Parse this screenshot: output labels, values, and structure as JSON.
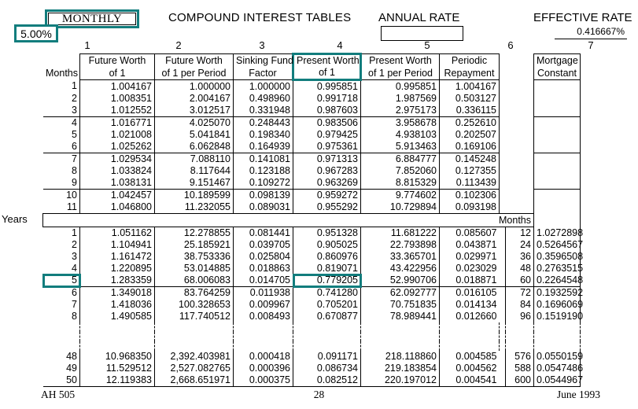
{
  "header": {
    "frequency_badge": "MONTHLY",
    "title": "COMPOUND INTEREST TABLES",
    "annual_rate_label": "ANNUAL RATE",
    "annual_rate_value": "5.00%",
    "effective_rate_label": "EFFECTIVE RATE",
    "effective_rate_value": "0.416667%",
    "effective_rate_column_number": "7",
    "highlight_color": "#127D7D"
  },
  "table": {
    "column_numbers": [
      "1",
      "2",
      "3",
      "4",
      "5",
      "6",
      "7"
    ],
    "row_label_header": "Months",
    "years_label": "Years",
    "months_label": "Months",
    "headers": [
      {
        "line1": "Future Worth",
        "line2": "of 1"
      },
      {
        "line1": "Future Worth",
        "line2": "of 1 per Period"
      },
      {
        "line1": "Sinking Fund",
        "line2": "Factor"
      },
      {
        "line1": "Present Worth",
        "line2": "of 1"
      },
      {
        "line1": "Present Worth",
        "line2": "of 1 per Period"
      },
      {
        "line1": "Periodic",
        "line2": "Repayment"
      },
      {
        "line1": "Mortgage",
        "line2": "Constant"
      }
    ],
    "highlighted_header_index": 3,
    "monthly_rows": [
      {
        "n": "1",
        "c1": "1.004167",
        "c2": "1.000000",
        "c3": "1.000000",
        "c4": "0.995851",
        "c5": "0.995851",
        "c6": "1.004167"
      },
      {
        "n": "2",
        "c1": "1.008351",
        "c2": "2.004167",
        "c3": "0.498960",
        "c4": "0.991718",
        "c5": "1.987569",
        "c6": "0.503127"
      },
      {
        "n": "3",
        "c1": "1.012552",
        "c2": "3.012517",
        "c3": "0.331948",
        "c4": "0.987603",
        "c5": "2.975173",
        "c6": "0.336115"
      },
      {
        "n": "4",
        "c1": "1.016771",
        "c2": "4.025070",
        "c3": "0.248443",
        "c4": "0.983506",
        "c5": "3.958678",
        "c6": "0.252610"
      },
      {
        "n": "5",
        "c1": "1.021008",
        "c2": "5.041841",
        "c3": "0.198340",
        "c4": "0.979425",
        "c5": "4.938103",
        "c6": "0.202507"
      },
      {
        "n": "6",
        "c1": "1.025262",
        "c2": "6.062848",
        "c3": "0.164939",
        "c4": "0.975361",
        "c5": "5.913463",
        "c6": "0.169106"
      },
      {
        "n": "7",
        "c1": "1.029534",
        "c2": "7.088110",
        "c3": "0.141081",
        "c4": "0.971313",
        "c5": "6.884777",
        "c6": "0.145248"
      },
      {
        "n": "8",
        "c1": "1.033824",
        "c2": "8.117644",
        "c3": "0.123188",
        "c4": "0.967283",
        "c5": "7.852060",
        "c6": "0.127355"
      },
      {
        "n": "9",
        "c1": "1.038131",
        "c2": "9.151467",
        "c3": "0.109272",
        "c4": "0.963269",
        "c5": "8.815329",
        "c6": "0.113439"
      },
      {
        "n": "10",
        "c1": "1.042457",
        "c2": "10.189599",
        "c3": "0.098139",
        "c4": "0.959272",
        "c5": "9.774602",
        "c6": "0.102306"
      },
      {
        "n": "11",
        "c1": "1.046800",
        "c2": "11.232055",
        "c3": "0.089031",
        "c4": "0.955292",
        "c5": "10.729894",
        "c6": "0.093198"
      }
    ],
    "year_rows": [
      {
        "n": "1",
        "c1": "1.051162",
        "c2": "12.278855",
        "c3": "0.081441",
        "c4": "0.951328",
        "c5": "11.681222",
        "c6": "0.085607",
        "months": "12",
        "c7": "1.0272898"
      },
      {
        "n": "2",
        "c1": "1.104941",
        "c2": "25.185921",
        "c3": "0.039705",
        "c4": "0.905025",
        "c5": "22.793898",
        "c6": "0.043871",
        "months": "24",
        "c7": "0.5264567"
      },
      {
        "n": "3",
        "c1": "1.161472",
        "c2": "38.753336",
        "c3": "0.025804",
        "c4": "0.860976",
        "c5": "33.365701",
        "c6": "0.029971",
        "months": "36",
        "c7": "0.3596508"
      },
      {
        "n": "4",
        "c1": "1.220895",
        "c2": "53.014885",
        "c3": "0.018863",
        "c4": "0.819071",
        "c5": "43.422956",
        "c6": "0.023029",
        "months": "48",
        "c7": "0.2763515"
      },
      {
        "n": "5",
        "c1": "1.283359",
        "c2": "68.006083",
        "c3": "0.014705",
        "c4": "0.779205",
        "c5": "52.990706",
        "c6": "0.018871",
        "months": "60",
        "c7": "0.2264548"
      },
      {
        "n": "6",
        "c1": "1.349018",
        "c2": "83.764259",
        "c3": "0.011938",
        "c4": "0.741280",
        "c5": "62.092777",
        "c6": "0.016105",
        "months": "72",
        "c7": "0.1932592"
      },
      {
        "n": "7",
        "c1": "1.418036",
        "c2": "100.328653",
        "c3": "0.009967",
        "c4": "0.705201",
        "c5": "70.751835",
        "c6": "0.014134",
        "months": "84",
        "c7": "0.1696069"
      },
      {
        "n": "8",
        "c1": "1.490585",
        "c2": "117.740512",
        "c3": "0.008493",
        "c4": "0.670877",
        "c5": "78.989441",
        "c6": "0.012660",
        "months": "96",
        "c7": "0.1519190"
      }
    ],
    "tail_rows": [
      {
        "n": "48",
        "c1": "10.968350",
        "c2": "2,392.403981",
        "c3": "0.000418",
        "c4": "0.091171",
        "c5": "218.118860",
        "c6": "0.004585",
        "months": "576",
        "c7": "0.0550159"
      },
      {
        "n": "49",
        "c1": "11.529512",
        "c2": "2,527.082765",
        "c3": "0.000396",
        "c4": "0.086734",
        "c5": "219.183854",
        "c6": "0.004562",
        "months": "588",
        "c7": "0.0547486"
      },
      {
        "n": "50",
        "c1": "12.119383",
        "c2": "2,668.651971",
        "c3": "0.000375",
        "c4": "0.082512",
        "c5": "220.197012",
        "c6": "0.004541",
        "months": "600",
        "c7": "0.0544967"
      }
    ],
    "highlighted_year_row_index": 4,
    "highlighted_year_row_number": "5",
    "highlighted_year_row_c4": "0.779205"
  },
  "footer": {
    "left": "AH 505",
    "center": "28",
    "right": "June 1993"
  }
}
